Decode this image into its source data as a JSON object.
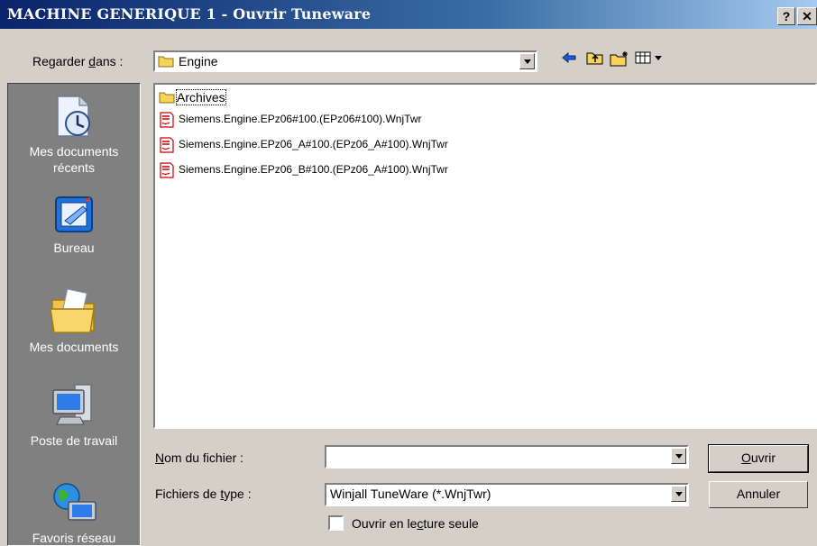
{
  "window": {
    "title": "MACHINE GENERIQUE 1 - Ouvrir Tuneware",
    "help_btn": "?",
    "close_btn": "✕"
  },
  "lookin": {
    "label_pre": "Regarder ",
    "label_ul": "d",
    "label_post": "ans :",
    "value": "Engine"
  },
  "toolbar": {
    "back_icon": "back-arrow-icon",
    "up_icon": "up-folder-icon",
    "new_folder_icon": "new-folder-icon",
    "view_icon": "view-menu-icon"
  },
  "places": [
    {
      "label": "Mes documents récents",
      "icon": "recent-documents-icon"
    },
    {
      "label": "Bureau",
      "icon": "desktop-icon"
    },
    {
      "label": "Mes documents",
      "icon": "my-documents-icon"
    },
    {
      "label": "Poste de travail",
      "icon": "my-computer-icon"
    },
    {
      "label": "Favoris réseau",
      "icon": "network-places-icon"
    }
  ],
  "files": [
    {
      "name": "Archives",
      "type": "folder"
    },
    {
      "name": "Siemens.Engine.EPz06#100.(EPz06#100).WnjTwr",
      "type": "tuneware"
    },
    {
      "name": "Siemens.Engine.EPz06_A#100.(EPz06_A#100).WnjTwr",
      "type": "tuneware"
    },
    {
      "name": "Siemens.Engine.EPz06_B#100.(EPz06_A#100).WnjTwr",
      "type": "tuneware"
    }
  ],
  "filename": {
    "label_ul": "N",
    "label_post": "om du fichier :",
    "value": ""
  },
  "filetype": {
    "label_pre": "Fichiers de ",
    "label_ul": "t",
    "label_post": "ype :",
    "value": "Winjall TuneWare (*.WnjTwr)"
  },
  "readonly": {
    "label_pre": "Ouvrir en le",
    "label_ul": "c",
    "label_post": "ture seule",
    "checked": false
  },
  "buttons": {
    "open_ul": "O",
    "open_post": "uvrir",
    "cancel": "Annuler"
  },
  "colors": {
    "title_start": "#0a246a",
    "title_end": "#a6caf0",
    "face": "#d4d0c8",
    "places_bg": "#808080",
    "file_icon_red": "#cc0000",
    "folder_yellow": "#f7d358"
  }
}
